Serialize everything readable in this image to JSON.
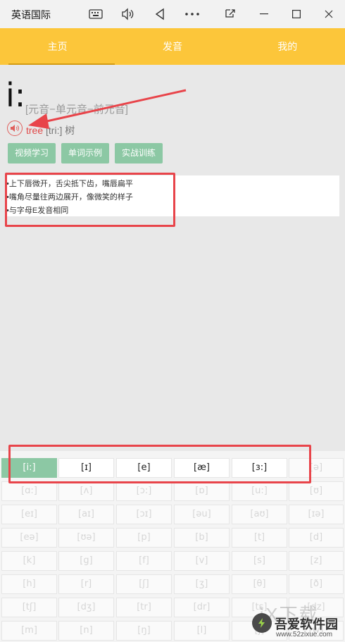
{
  "window": {
    "title": "英语国际",
    "controls": [
      "keyboard-icon",
      "speaker-icon",
      "back-icon",
      "more-icon",
      "restore-small-icon",
      "minimize-icon",
      "maximize-icon",
      "close-icon"
    ]
  },
  "nav": {
    "tabs": [
      {
        "label": "主页",
        "active": true
      },
      {
        "label": "发音",
        "active": false
      },
      {
        "label": "我的",
        "active": false
      }
    ]
  },
  "phoneme": {
    "symbol": "i:",
    "category": "[元音−单元音−前元音]",
    "example_word": "tree",
    "example_ipa": "[tri:]",
    "example_meaning": "树"
  },
  "actions": [
    "视频学习",
    "单词示例",
    "实战训练"
  ],
  "tips": [
    "•上下唇微开，舌尖抵下齿，嘴唇扁平",
    "•嘴角尽量往两边展开，像微笑的样子",
    "•与字母E发音相同"
  ],
  "grid": {
    "rows": [
      [
        "[i:]",
        "[ɪ]",
        "[e]",
        "[æ]",
        "[ɜ:]",
        "[ə]"
      ],
      [
        "[ɑ:]",
        "[ʌ]",
        "[ɔ:]",
        "[ɒ]",
        "[u:]",
        "[ʊ]"
      ],
      [
        "[eɪ]",
        "[aɪ]",
        "[ɔɪ]",
        "[əu]",
        "[aʊ]",
        "[ɪə]"
      ],
      [
        "[eə]",
        "[ʊə]",
        "[p]",
        "[b]",
        "[t]",
        "[d]"
      ],
      [
        "[k]",
        "[g]",
        "[f]",
        "[v]",
        "[s]",
        "[z]"
      ],
      [
        "[h]",
        "[r]",
        "[ʃ]",
        "[ʒ]",
        "[θ]",
        "[ð]"
      ],
      [
        "[tʃ]",
        "[dʒ]",
        "[tr]",
        "[dr]",
        "[ts]",
        "[dz]"
      ],
      [
        "[m]",
        "[n]",
        "[ŋ]",
        "[l]",
        "[j]",
        "[w]"
      ]
    ],
    "active": "[i:]",
    "highlighted_row_count": 5
  },
  "watermark": {
    "text": "吾爱软件园",
    "url": "www.52zixue.com",
    "top_text": "ìX下载"
  },
  "colors": {
    "accent": "#fcc63a",
    "green": "#8cc8a4",
    "annotation_red": "#e8444a"
  }
}
